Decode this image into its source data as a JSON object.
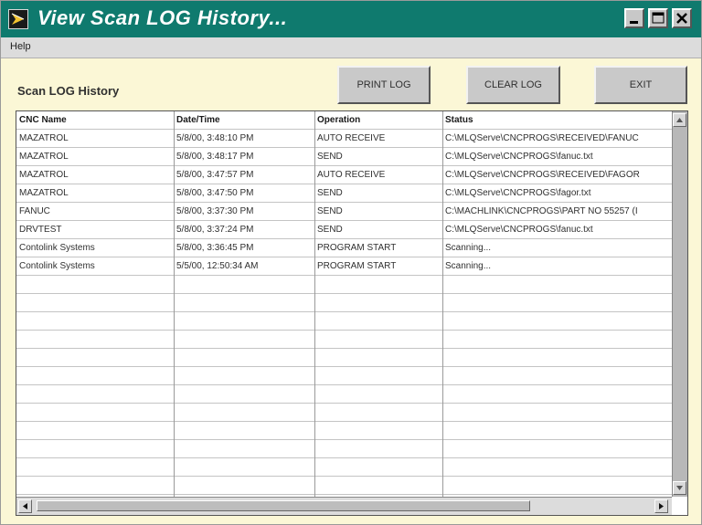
{
  "window": {
    "title": "View Scan LOG History...",
    "titlebar_color": "#0f7a6e",
    "background_color": "#fbf7d6",
    "controls": [
      "minimize-icon",
      "maximize-icon",
      "close-icon"
    ]
  },
  "menu": {
    "help_label": "Help"
  },
  "section_label": "Scan LOG History",
  "buttons": {
    "print_log": "PRINT LOG",
    "clear_log": "CLEAR LOG",
    "exit": "EXIT"
  },
  "table": {
    "columns": [
      "CNC Name",
      "Date/Time",
      "Operation",
      "Status"
    ],
    "rows": [
      [
        "MAZATROL",
        "5/8/00, 3:48:10 PM",
        "AUTO RECEIVE",
        "C:\\MLQServe\\CNCPROGS\\RECEIVED\\FANUC"
      ],
      [
        "MAZATROL",
        "5/8/00, 3:48:17 PM",
        "SEND",
        "C:\\MLQServe\\CNCPROGS\\fanuc.txt"
      ],
      [
        "MAZATROL",
        "5/8/00, 3:47:57 PM",
        "AUTO RECEIVE",
        "C:\\MLQServe\\CNCPROGS\\RECEIVED\\FAGOR"
      ],
      [
        "MAZATROL",
        "5/8/00, 3:47:50 PM",
        "SEND",
        "C:\\MLQServe\\CNCPROGS\\fagor.txt"
      ],
      [
        "FANUC",
        "5/8/00, 3:37:30 PM",
        "SEND",
        "C:\\MACHLINK\\CNCPROGS\\PART NO 55257 (I"
      ],
      [
        "DRVTEST",
        "5/8/00, 3:37:24 PM",
        "SEND",
        "C:\\MLQServe\\CNCPROGS\\fanuc.txt"
      ],
      [
        "Contolink Systems",
        "5/8/00, 3:36:45 PM",
        "PROGRAM START",
        "Scanning..."
      ],
      [
        "Contolink Systems",
        "5/5/00, 12:50:34 AM",
        "PROGRAM START",
        "Scanning..."
      ]
    ]
  }
}
